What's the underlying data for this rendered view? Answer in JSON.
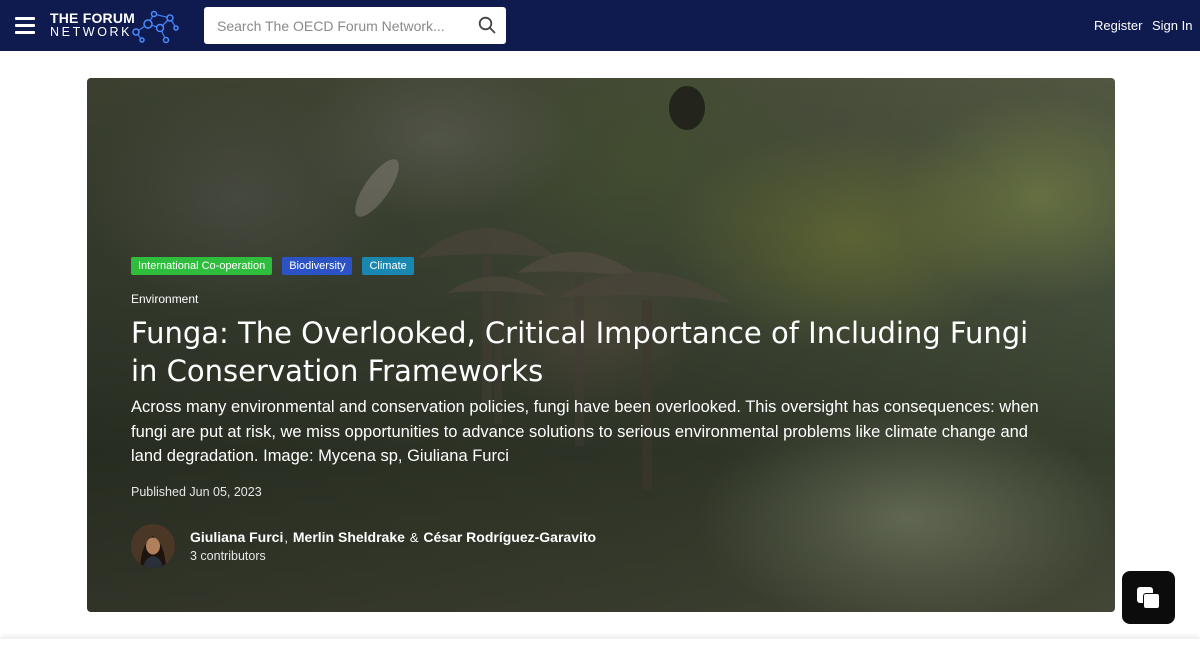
{
  "header": {
    "logo_line1": "THE FORUM",
    "logo_line2": "NETWORK",
    "search_placeholder": "Search The OECD Forum Network...",
    "register_label": "Register",
    "signin_label": "Sign In",
    "background_color": "#0f1a4f"
  },
  "article": {
    "tags": [
      {
        "label": "International Co-operation",
        "color": "#2ebd3c"
      },
      {
        "label": "Biodiversity",
        "color": "#2b53c6"
      },
      {
        "label": "Climate",
        "color": "#1987b0"
      }
    ],
    "category": "Environment",
    "title": "Funga: The Overlooked, Critical Importance of Including Fungi in Conservation Frameworks",
    "description": "Across many environmental and conservation policies, fungi have been overlooked. This oversight has consequences: when fungi are put at risk, we miss opportunities to advance solutions to serious environmental problems like climate change and land degradation. Image: Mycena sp, Giuliana Furci",
    "published": "Published Jun 05, 2023",
    "authors": [
      "Giuliana Furci",
      "Merlin Sheldrake",
      "César Rodríguez-Garavito"
    ],
    "author_sep_1": ",",
    "author_sep_2": "&",
    "contributors": "3 contributors"
  },
  "chat_widget": {
    "icon": "chat-bubbles-icon"
  }
}
